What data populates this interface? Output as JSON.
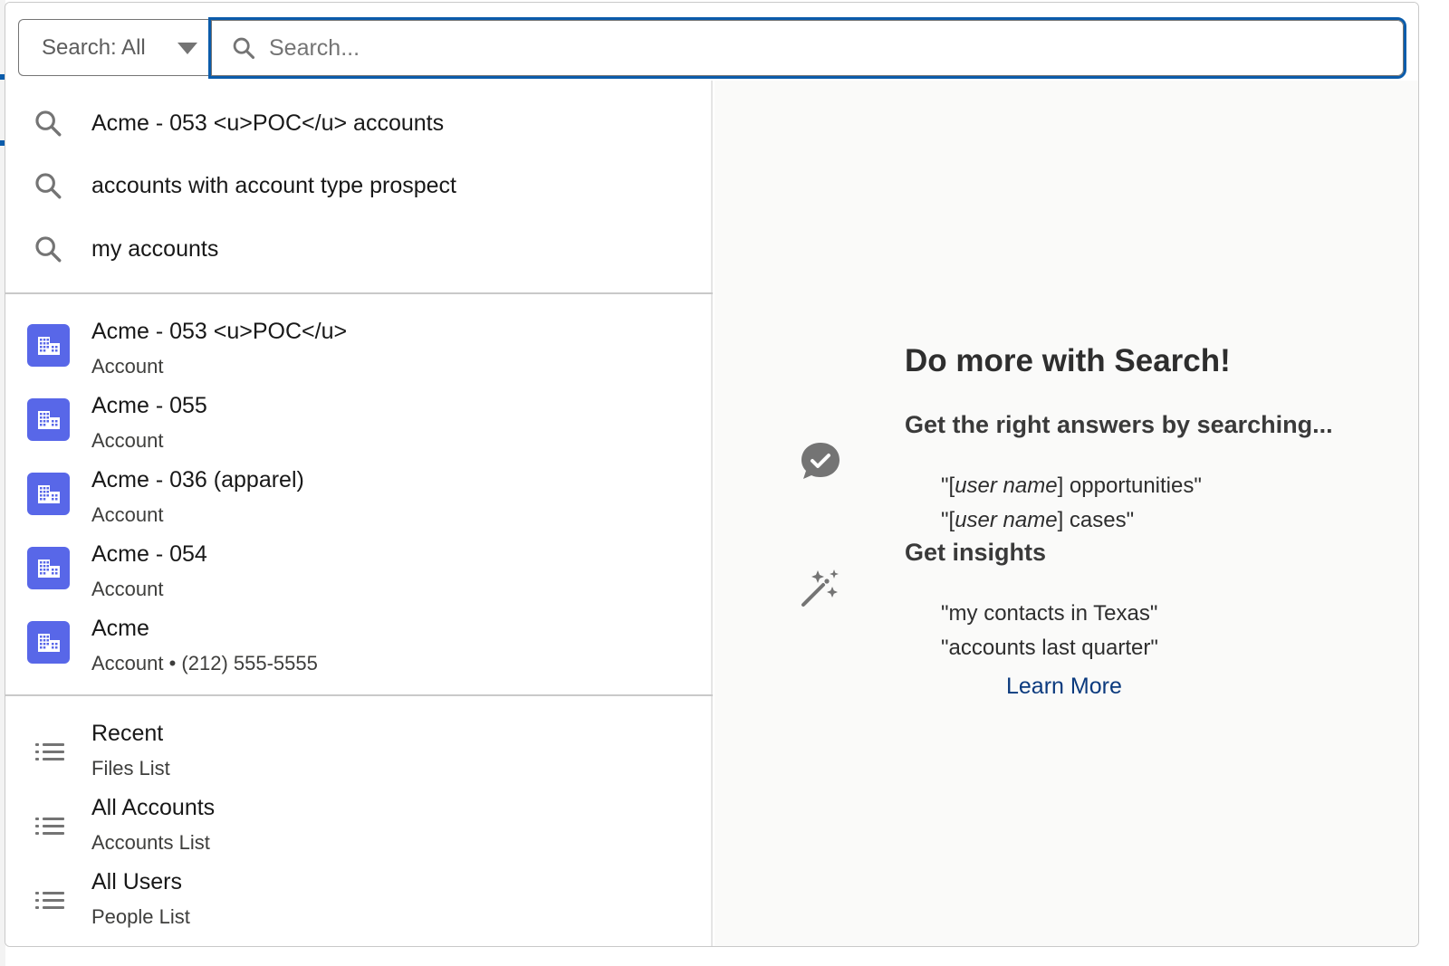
{
  "search": {
    "scope_label": "Search: All",
    "placeholder": "Search...",
    "value": ""
  },
  "suggestions": [
    {
      "icon": "search-icon",
      "label": "Acme - 053 <u>POC</u> accounts"
    },
    {
      "icon": "search-icon",
      "label": "accounts with account type prospect"
    },
    {
      "icon": "search-icon",
      "label": "my accounts"
    }
  ],
  "records": [
    {
      "icon": "account-building-icon",
      "title": "Acme - 053 <u>POC</u>",
      "subtitle": "Account"
    },
    {
      "icon": "account-building-icon",
      "title": "Acme - 055",
      "subtitle": "Account"
    },
    {
      "icon": "account-building-icon",
      "title": "Acme - 036 (apparel)",
      "subtitle": "Account"
    },
    {
      "icon": "account-building-icon",
      "title": "Acme - 054",
      "subtitle": "Account"
    },
    {
      "icon": "account-building-icon",
      "title": "Acme",
      "subtitle": "Account • (212) 555-5555"
    }
  ],
  "list_views": [
    {
      "icon": "list-icon",
      "title": "Recent",
      "subtitle": "Files List"
    },
    {
      "icon": "list-icon",
      "title": "All Accounts",
      "subtitle": "Accounts List"
    },
    {
      "icon": "list-icon",
      "title": "All Users",
      "subtitle": "People List"
    }
  ],
  "promo": {
    "heading": "Do more with Search!",
    "sections": [
      {
        "icon": "chat-check-icon",
        "title": "Get the right answers by searching...",
        "examples": [
          {
            "prefix": "\"[",
            "italic": "user name",
            "suffix": "] opportunities\""
          },
          {
            "prefix": "\"[",
            "italic": "user name",
            "suffix": "] cases\""
          }
        ]
      },
      {
        "icon": "magic-wand-icon",
        "title": "Get insights",
        "examples": [
          {
            "prefix": "\"my contacts in Texas\"",
            "italic": "",
            "suffix": ""
          },
          {
            "prefix": "\"accounts last quarter\"",
            "italic": "",
            "suffix": ""
          }
        ]
      }
    ],
    "learn_more": "Learn More"
  },
  "colors": {
    "focus_border": "#0b5cab",
    "account_icon_bg": "#5867e8",
    "link": "#0b3a7e",
    "promo_bg": "#fafaf9"
  }
}
